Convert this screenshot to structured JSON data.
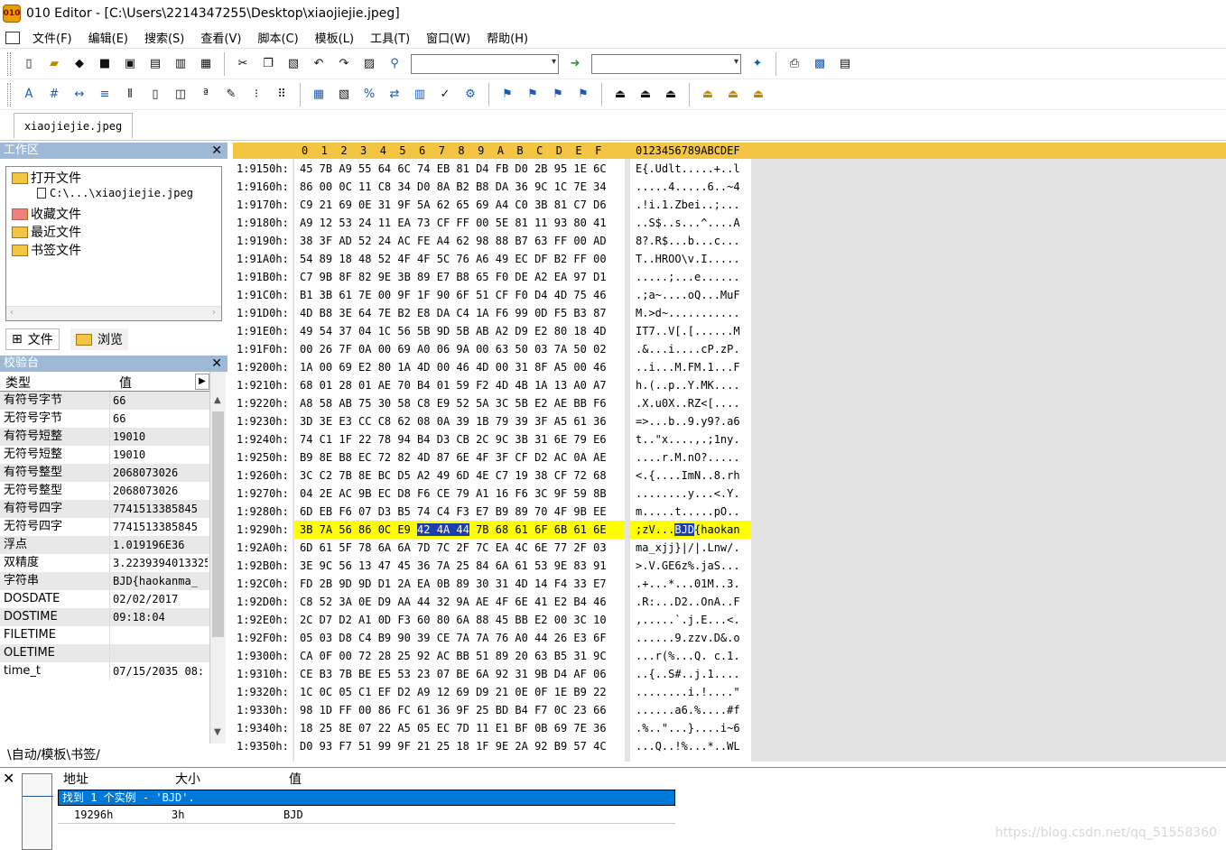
{
  "titlebar": {
    "logo": "010",
    "title": "010 Editor - [C:\\Users\\2214347255\\Desktop\\xiaojiejie.jpeg]"
  },
  "menu": [
    "文件(F)",
    "编辑(E)",
    "搜索(S)",
    "查看(V)",
    "脚本(C)",
    "模板(L)",
    "工具(T)",
    "窗口(W)",
    "帮助(H)"
  ],
  "file_tab": "xiaojiejie.jpeg",
  "workspace": {
    "title": "工作区",
    "open_files": "打开文件",
    "file_path": "C:\\...\\xiaojiejie.jpeg",
    "favorites": "收藏文件",
    "recent": "最近文件",
    "bookmarks": "书签文件",
    "tab_files": "文件",
    "tab_browse": "浏览"
  },
  "inspector": {
    "title": "校验台",
    "col_type": "类型",
    "col_value": "值",
    "rows": [
      {
        "k": "有符号字节",
        "v": "66"
      },
      {
        "k": "无符号字节",
        "v": "66"
      },
      {
        "k": "有符号短整",
        "v": "19010"
      },
      {
        "k": "无符号短整",
        "v": "19010"
      },
      {
        "k": "有符号整型",
        "v": "2068073026"
      },
      {
        "k": "无符号整型",
        "v": "2068073026"
      },
      {
        "k": "有符号四字",
        "v": "7741513385845"
      },
      {
        "k": "无符号四字",
        "v": "7741513385845"
      },
      {
        "k": "浮点",
        "v": "1.019196E36"
      },
      {
        "k": "双精度",
        "v": "3.2239394013325"
      },
      {
        "k": "字符串",
        "v": "BJD{haokanma_"
      },
      {
        "k": "DOSDATE",
        "v": "02/02/2017"
      },
      {
        "k": "DOSTIME",
        "v": "09:18:04"
      },
      {
        "k": "FILETIME",
        "v": ""
      },
      {
        "k": "OLETIME",
        "v": ""
      },
      {
        "k": "time_t",
        "v": "07/15/2035 08:"
      }
    ],
    "tabs": "\\自动/模板\\书签/"
  },
  "hex": {
    "col_header": "0  1  2  3  4  5  6  7  8  9  A  B  C  D  E  F",
    "ascii_header": "0123456789ABCDEF",
    "rows": [
      {
        "addr": "1:9150h:",
        "bytes": "45 7B A9 55 64 6C 74 EB 81 D4 FB D0 2B 95 1E 6C",
        "ascii": "E{.Udlt.....+..l"
      },
      {
        "addr": "1:9160h:",
        "bytes": "86 00 0C 11 C8 34 D0 8A B2 B8 DA 36 9C 1C 7E 34",
        "ascii": ".....4.....6..~4"
      },
      {
        "addr": "1:9170h:",
        "bytes": "C9 21 69 0E 31 9F 5A 62 65 69 A4 C0 3B 81 C7 D6",
        "ascii": ".!i.1.Zbei..;..."
      },
      {
        "addr": "1:9180h:",
        "bytes": "A9 12 53 24 11 EA 73 CF FF 00 5E 81 11 93 80 41",
        "ascii": "..S$..s...^....A"
      },
      {
        "addr": "1:9190h:",
        "bytes": "38 3F AD 52 24 AC FE A4 62 98 88 B7 63 FF 00 AD",
        "ascii": "8?.R$...b...c..."
      },
      {
        "addr": "1:91A0h:",
        "bytes": "54 89 18 48 52 4F 4F 5C 76 A6 49 EC DF B2 FF 00",
        "ascii": "T..HROO\\v.I....."
      },
      {
        "addr": "1:91B0h:",
        "bytes": "C7 9B 8F 82 9E 3B 89 E7 B8 65 F0 DE A2 EA 97 D1",
        "ascii": ".....;...e......"
      },
      {
        "addr": "1:91C0h:",
        "bytes": "B1 3B 61 7E 00 9F 1F 90 6F 51 CF F0 D4 4D 75 46",
        "ascii": ".;a~....oQ...MuF"
      },
      {
        "addr": "1:91D0h:",
        "bytes": "4D B8 3E 64 7E B2 E8 DA C4 1A F6 99 0D F5 B3 87",
        "ascii": "M.>d~..........."
      },
      {
        "addr": "1:91E0h:",
        "bytes": "49 54 37 04 1C 56 5B 9D 5B AB A2 D9 E2 80 18 4D",
        "ascii": "IT7..V[.[......M"
      },
      {
        "addr": "1:91F0h:",
        "bytes": "00 26 7F 0A 00 69 A0 06 9A 00 63 50 03 7A 50 02",
        "ascii": ".&...i....cP.zP."
      },
      {
        "addr": "1:9200h:",
        "bytes": "1A 00 69 E2 80 1A 4D 00 46 4D 00 31 8F A5 00 46",
        "ascii": "..i...M.FM.1...F"
      },
      {
        "addr": "1:9210h:",
        "bytes": "68 01 28 01 AE 70 B4 01 59 F2 4D 4B 1A 13 A0 A7",
        "ascii": "h.(..p..Y.MK...."
      },
      {
        "addr": "1:9220h:",
        "bytes": "A8 58 AB 75 30 58 C8 E9 52 5A 3C 5B E2 AE BB F6",
        "ascii": ".X.u0X..RZ<[...."
      },
      {
        "addr": "1:9230h:",
        "bytes": "3D 3E E3 CC C8 62 08 0A 39 1B 79 39 3F A5 61 36",
        "ascii": "=>...b..9.y9?.a6"
      },
      {
        "addr": "1:9240h:",
        "bytes": "74 C1 1F 22 78 94 B4 D3 CB 2C 9C 3B 31 6E 79 E6",
        "ascii": "t..\"x....,.;1ny."
      },
      {
        "addr": "1:9250h:",
        "bytes": "B9 8E B8 EC 72 82 4D 87 6E 4F 3F CF D2 AC 0A AE",
        "ascii": "....r.M.nO?....."
      },
      {
        "addr": "1:9260h:",
        "bytes": "3C C2 7B 8E BC D5 A2 49 6D 4E C7 19 38 CF 72 68",
        "ascii": "<.{....ImN..8.rh"
      },
      {
        "addr": "1:9270h:",
        "bytes": "04 2E AC 9B EC D8 F6 CE 79 A1 16 F6 3C 9F 59 8B",
        "ascii": "........y...<.Y."
      },
      {
        "addr": "1:9280h:",
        "bytes": "6D EB F6 07 D3 B5 74 C4 F3 E7 B9 89 70 4F 9B EE",
        "ascii": "m.....t.....pO.."
      },
      {
        "addr": "1:9290h:",
        "bytes": "3B 7A 56 86 0C E9 42 4A 44 7B 68 61 6F 6B 61 6E",
        "ascii": ";zV...BJD{haokan",
        "selected": true
      },
      {
        "addr": "1:92A0h:",
        "bytes": "6D 61 5F 78 6A 6A 7D 7C 2F 7C EA 4C 6E 77 2F 03",
        "ascii": "ma_xjj}|/|.Lnw/."
      },
      {
        "addr": "1:92B0h:",
        "bytes": "3E 9C 56 13 47 45 36 7A 25 84 6A 61 53 9E 83 91",
        "ascii": ">.V.GE6z%.jaS..."
      },
      {
        "addr": "1:92C0h:",
        "bytes": "FD 2B 9D 9D D1 2A EA 0B 89 30 31 4D 14 F4 33 E7",
        "ascii": ".+...*...01M..3."
      },
      {
        "addr": "1:92D0h:",
        "bytes": "C8 52 3A 0E D9 AA 44 32 9A AE 4F 6E 41 E2 B4 46",
        "ascii": ".R:...D2..OnA..F"
      },
      {
        "addr": "1:92E0h:",
        "bytes": "2C D7 D2 A1 0D F3 60 80 6A 88 45 BB E2 00 3C 10",
        "ascii": ",.....`.j.E...<."
      },
      {
        "addr": "1:92F0h:",
        "bytes": "05 03 D8 C4 B9 90 39 CE 7A 7A 76 A0 44 26 E3 6F",
        "ascii": "......9.zzv.D&.o"
      },
      {
        "addr": "1:9300h:",
        "bytes": "CA 0F 00 72 28 25 92 AC BB 51 89 20 63 B5 31 9C",
        "ascii": "...r(%...Q. c.1."
      },
      {
        "addr": "1:9310h:",
        "bytes": "CE B3 7B BE E5 53 23 07 BE 6A 92 31 9B D4 AF 06",
        "ascii": "..{..S#..j.1...."
      },
      {
        "addr": "1:9320h:",
        "bytes": "1C 0C 05 C1 EF D2 A9 12 69 D9 21 0E 0F 1E B9 22",
        "ascii": "........i.!....\""
      },
      {
        "addr": "1:9330h:",
        "bytes": "98 1D FF 00 86 FC 61 36 9F 25 BD B4 F7 0C 23 66",
        "ascii": "......a6.%....#f"
      },
      {
        "addr": "1:9340h:",
        "bytes": "18 25 8E 07 22 A5 05 EC 7D 11 E1 BF 0B 69 7E 36",
        "ascii": ".%..\"...}....i~6"
      },
      {
        "addr": "1:9350h:",
        "bytes": "D0 93 F7 51 99 9F 21 25 18 1F 9E 2A 92 B9 57 4C",
        "ascii": "...Q..!%...*..WL"
      }
    ]
  },
  "results": {
    "col_addr": "地址",
    "col_size": "大小",
    "col_value": "值",
    "found": "找到 1 个实例 - 'BJD'.",
    "addr": "19296h",
    "size": "3h",
    "value": "BJD"
  },
  "watermark": "https://blog.csdn.net/qq_51558360"
}
